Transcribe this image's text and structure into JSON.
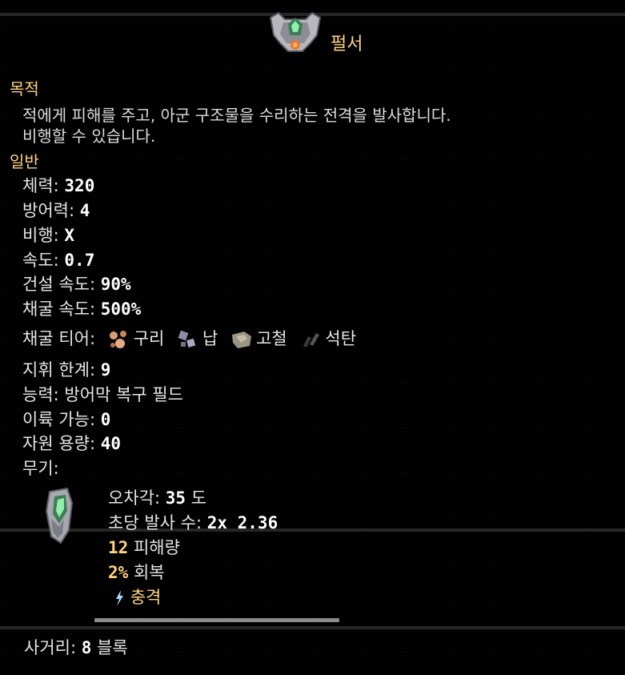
{
  "unit": {
    "name": "펄서",
    "icon": "pulsar-mech-icon"
  },
  "purpose": {
    "heading": "목적",
    "description_line1": "적에게 피해를 주고, 아군 구조물을 수리하는 전격을 발사합니다.",
    "description_line2": "비행할 수 있습니다."
  },
  "general": {
    "heading": "일반",
    "health_label": "체력:",
    "health_value": "320",
    "armor_label": "방어력:",
    "armor_value": "4",
    "flying_label": "비행:",
    "flying_value": "X",
    "speed_label": "속도:",
    "speed_value": "0.7",
    "build_speed_label": "건설 속도:",
    "build_speed_value": "90%",
    "mine_speed_label": "채굴 속도:",
    "mine_speed_value": "500%",
    "mine_tier_label": "채굴 티어:",
    "ores": [
      {
        "name": "구리",
        "icon": "copper-ore-icon"
      },
      {
        "name": "납",
        "icon": "lead-ore-icon"
      },
      {
        "name": "고철",
        "icon": "scrap-ore-icon"
      },
      {
        "name": "석탄",
        "icon": "coal-ore-icon"
      }
    ],
    "command_limit_label": "지휘 한계:",
    "command_limit_value": "9",
    "ability_label": "능력:",
    "ability_value": "방어막 복구 필드",
    "payload_label": "이륙 가능:",
    "payload_value": "0",
    "item_capacity_label": "자원 용량:",
    "item_capacity_value": "40",
    "weapons_label": "무기:"
  },
  "weapon": {
    "icon": "pulsar-weapon-icon",
    "inaccuracy_label": "오차각:",
    "inaccuracy_value": "35",
    "inaccuracy_unit": "도",
    "fire_rate_label": "초당 발사 수:",
    "fire_rate_value": "2x 2.36",
    "damage_value": "12",
    "damage_label": "피해량",
    "heal_value": "2%",
    "heal_label": "회복",
    "status_icon": "shocked-status-icon",
    "status_label": "충격"
  },
  "range": {
    "label": "사거리:",
    "value": "8",
    "unit": "블록"
  },
  "colors": {
    "accent": "#ffd37f",
    "text": "#e6e6e6",
    "background": "#060606"
  }
}
